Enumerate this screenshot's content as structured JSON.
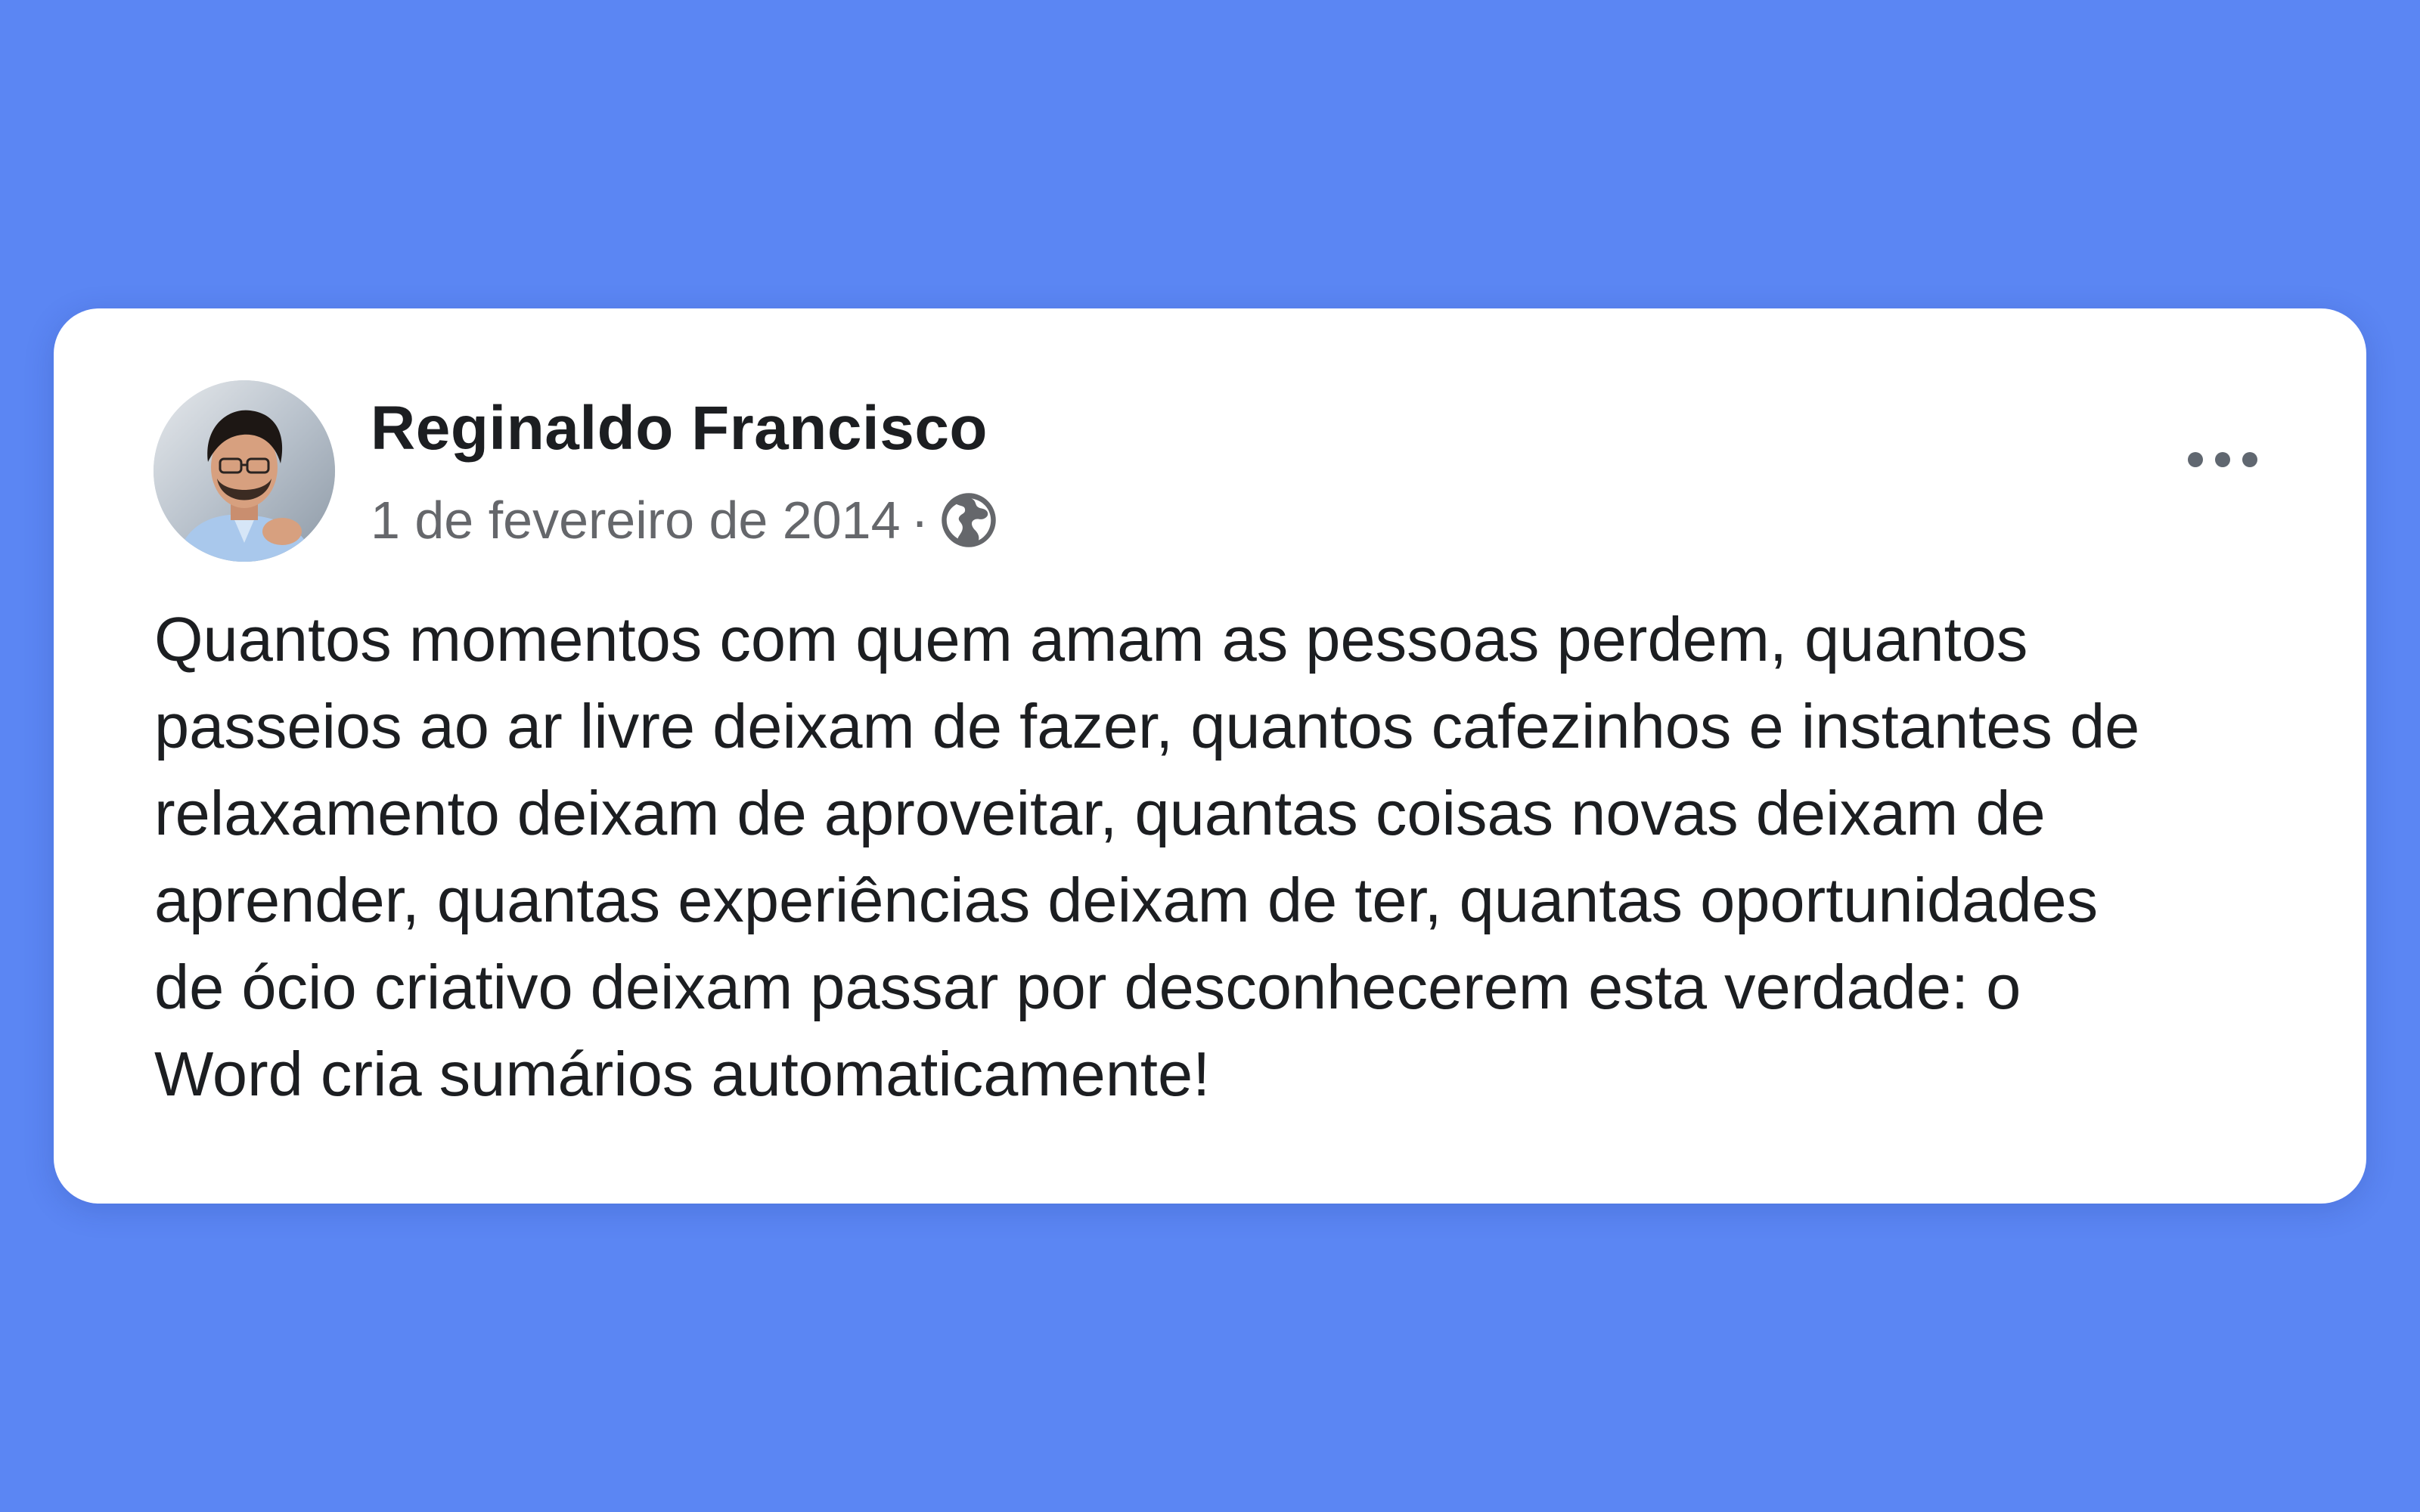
{
  "post": {
    "author": "Reginaldo Francisco",
    "date": "1 de fevereiro de 2014",
    "separator": "·",
    "privacy_icon": "globe-icon",
    "menu_icon": "more-options-icon",
    "text_lines": [
      "Quantos momentos com quem amam as pessoas perdem, quantos",
      "passeios ao ar livre deixam de fazer, quantos cafezinhos e instantes de",
      "relaxamento deixam de aproveitar, quantas coisas novas deixam de",
      "aprender, quantas experiências deixam de ter, quantas oportunidades",
      "de ócio criativo deixam passar por desconhecerem esta verdade: o",
      "Word cria sumários automaticamente!"
    ]
  },
  "colors": {
    "background": "#5b86f3",
    "card": "#ffffff",
    "text_primary": "#1c1e21",
    "text_secondary": "#65676b"
  }
}
